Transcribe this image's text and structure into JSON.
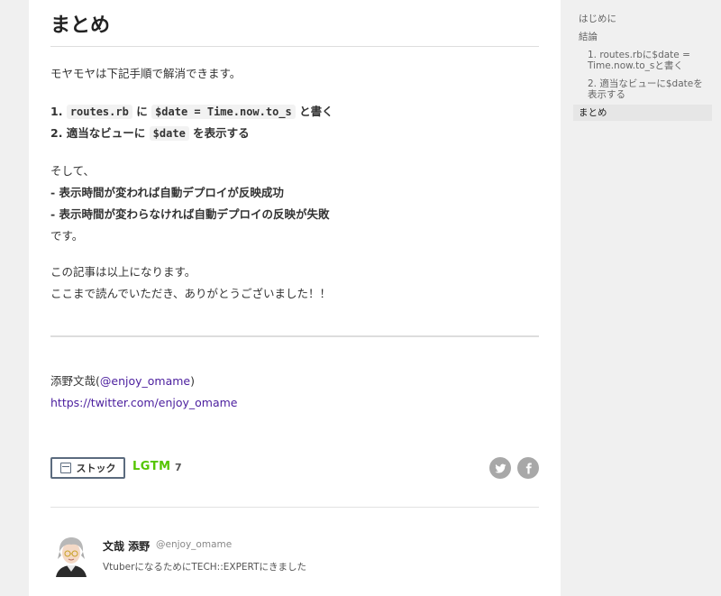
{
  "article": {
    "heading": "まとめ",
    "intro": "モヤモヤは下記手順で解消できます。",
    "steps": [
      {
        "num": "1.",
        "code1": "routes.rb",
        "mid": " に ",
        "code2": "$date = Time.now.to_s",
        "tail": " と書く"
      },
      {
        "num": "2.",
        "text": " 適当なビューに ",
        "code1": "$date",
        "tail": " を表示する"
      }
    ],
    "then": "そして、",
    "bullet1": "- 表示時間が変われば自動デプロイが反映成功",
    "bullet2": "- 表示時間が変わらなければ自動デプロイの反映が失敗",
    "desu": "です。",
    "closing1": "この記事は以上になります。",
    "closing2": "ここまで読んでいただき、ありがとうございました！！",
    "signature_name": "添野文哉(",
    "signature_handle": "@enjoy_omame",
    "signature_close": ")",
    "twitter_url": "https://twitter.com/enjoy_omame"
  },
  "actions": {
    "stock_label": "ストック",
    "lgtm_label": "LGTM",
    "lgtm_count": "7",
    "twitter_icon": "twitter-icon",
    "facebook_icon": "facebook-icon"
  },
  "author": {
    "name": "文哉 添野",
    "handle": "@enjoy_omame",
    "bio": "VtuberになるためにTECH::EXPERTにきました"
  },
  "toc": {
    "items": [
      {
        "label": "はじめに",
        "level": 1,
        "active": false
      },
      {
        "label": "結論",
        "level": 1,
        "active": false
      },
      {
        "label": "1. routes.rbに$date = Time.now.to_sと書く",
        "level": 2,
        "active": false
      },
      {
        "label": "2. 適当なビューに$dateを表示する",
        "level": 2,
        "active": false
      },
      {
        "label": "まとめ",
        "level": 1,
        "active": true
      }
    ]
  },
  "colors": {
    "lgtm_green": "#55c500",
    "link_purple": "#4b1e9e",
    "share_gray": "#a8a8a8"
  }
}
